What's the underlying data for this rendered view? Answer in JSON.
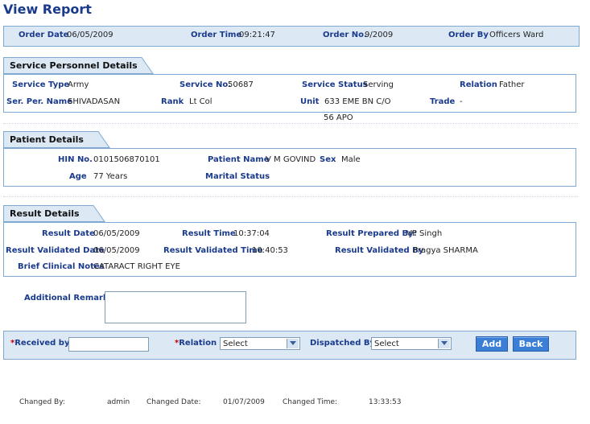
{
  "page_title": "View Report",
  "order": {
    "date_label": "Order Date",
    "date": "06/05/2009",
    "time_label": "Order Time",
    "time": "09:21:47",
    "no_label": "Order No.",
    "no": "9/2009",
    "by_label": "Order By",
    "by": "Officers Ward"
  },
  "service": {
    "tab": "Service Personnel Details",
    "type_label": "Service Type",
    "type": "Army",
    "no_label": "Service No.",
    "no": "50687",
    "status_label": "Service Status",
    "status": "Serving",
    "relation_label": "Relation",
    "relation": "Father",
    "name_label": "Ser. Per. Name",
    "name": "SHIVADASAN",
    "rank_label": "Rank",
    "rank": "Lt Col",
    "unit_label": "Unit",
    "unit_line1": "633 EME BN C/O",
    "unit_line2": "56 APO",
    "trade_label": "Trade",
    "trade": "-"
  },
  "patient": {
    "tab": "Patient Details",
    "hin_label": "HIN No.",
    "hin": "0101506870101",
    "name_label": "Patient Name",
    "name": "V M GOVIND",
    "sex_label": "Sex",
    "sex": "Male",
    "age_label": "Age",
    "age": "77 Years",
    "marital_label": "Marital Status",
    "marital": "-"
  },
  "result": {
    "tab": "Result Details",
    "date_label": "Result Date",
    "date": "06/05/2009",
    "time_label": "Result Time",
    "time": "10:37:04",
    "prepared_label": "Result Prepared By:",
    "prepared": "VP Singh",
    "vdate_label": "Result Validated Date",
    "vdate": "06/05/2009",
    "vtime_label": "Result Validated Time",
    "vtime": "10:40:53",
    "vby_label": "Result Validated By",
    "vby": "Pragya SHARMA",
    "notes_label": "Brief Clinical Notes",
    "notes": "CATARACT RIGHT EYE"
  },
  "remarks": {
    "label": "Additional Remarks",
    "value": ""
  },
  "dispatch": {
    "required_mark": "*",
    "received_label": "Received by",
    "received_value": "",
    "relation_label": "Relation",
    "relation_selected": "Select",
    "dispatched_label": "Dispatched By",
    "dispatched_selected": "Select",
    "add_label": "Add",
    "back_label": "Back"
  },
  "footer": {
    "changed_by_label": "Changed By:",
    "changed_by": "admin",
    "changed_date_label": "Changed Date:",
    "changed_date": "01/07/2009",
    "changed_time_label": "Changed Time:",
    "changed_time": "13:33:53"
  },
  "colors": {
    "heading": "#1a3a8c",
    "bar_bg": "#dce9f5",
    "border": "#7fa9d1",
    "button": "#3a7fd5",
    "required": "#c00000"
  }
}
